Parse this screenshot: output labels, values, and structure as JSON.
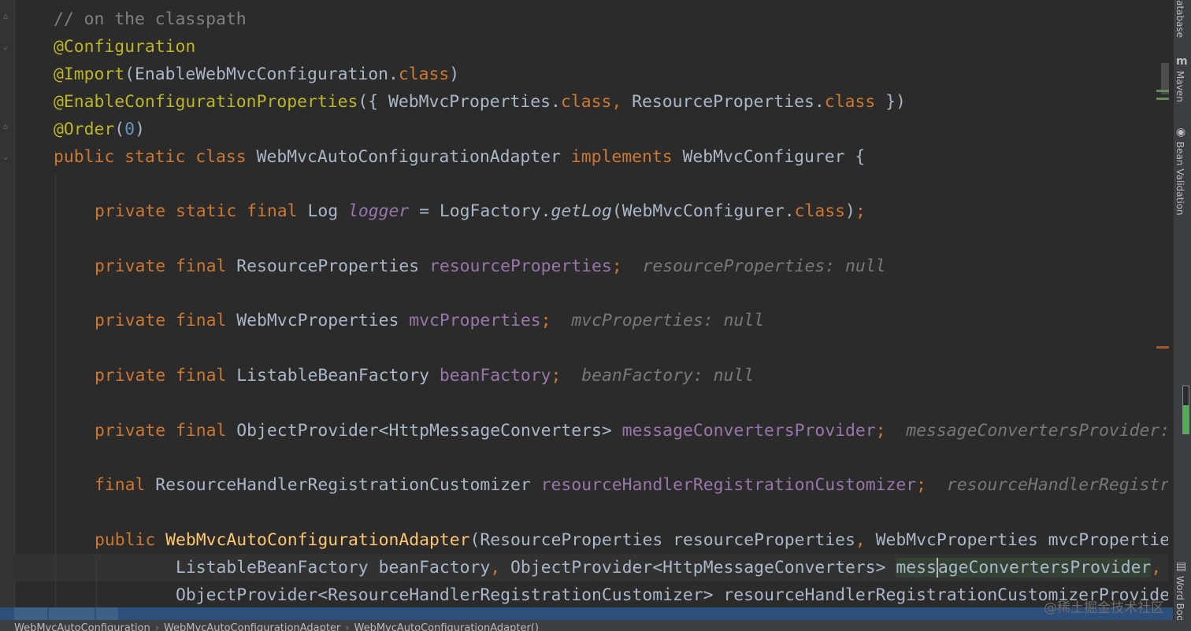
{
  "editor": {
    "lines": [
      "// on the classpath",
      "@Configuration",
      "@Import(EnableWebMvcConfiguration.class)",
      "@EnableConfigurationProperties({ WebMvcProperties.class, ResourceProperties.class })",
      "@Order(0)",
      "public static class WebMvcAutoConfigurationAdapter implements WebMvcConfigurer {",
      "private static final Log logger = LogFactory.getLog(WebMvcConfigurer.class);",
      "private final ResourceProperties resourceProperties;",
      "private final WebMvcProperties mvcProperties;",
      "private final ListableBeanFactory beanFactory;",
      "private final ObjectProvider<HttpMessageConverters> messageConvertersProvider;",
      "final ResourceHandlerRegistrationCustomizer resourceHandlerRegistrationCustomizer;",
      "public WebMvcAutoConfigurationAdapter(ResourceProperties resourceProperties, WebMvcProperties mvcPropertie",
      "ListableBeanFactory beanFactory, ObjectProvider<HttpMessageConverters> messageConvertersProvider,",
      "ObjectProvider<ResourceHandlerRegistrationCustomizer> resourceHandlerRegistrationCustomizerProvide"
    ],
    "inlay_hints": {
      "resourceProperties": "resourceProperties: null",
      "mvcProperties": "mvcProperties: null",
      "beanFactory": "beanFactory: null",
      "messageConvertersProvider": "messageConvertersProvider:",
      "resourceHandlerRegistrationCustomizer": "resourceHandlerRegistr"
    }
  },
  "tool_windows": {
    "database": "atabase",
    "maven": "Maven",
    "bean_validation": "Bean Validation",
    "word_book": "Word Boo"
  },
  "breadcrumbs": [
    "WebMvcAutoConfiguration",
    "WebMvcAutoConfigurationAdapter",
    "WebMvcAutoConfigurationAdapter()"
  ],
  "watermark": "@稀土掘金技术社区",
  "colors": {
    "background": "#2b2b2b",
    "keyword": "#cc7832",
    "annotation": "#bbb529",
    "field": "#9876aa",
    "method": "#ffc66d",
    "comment": "#808080",
    "number": "#6897bb",
    "text": "#a9b7c6"
  }
}
